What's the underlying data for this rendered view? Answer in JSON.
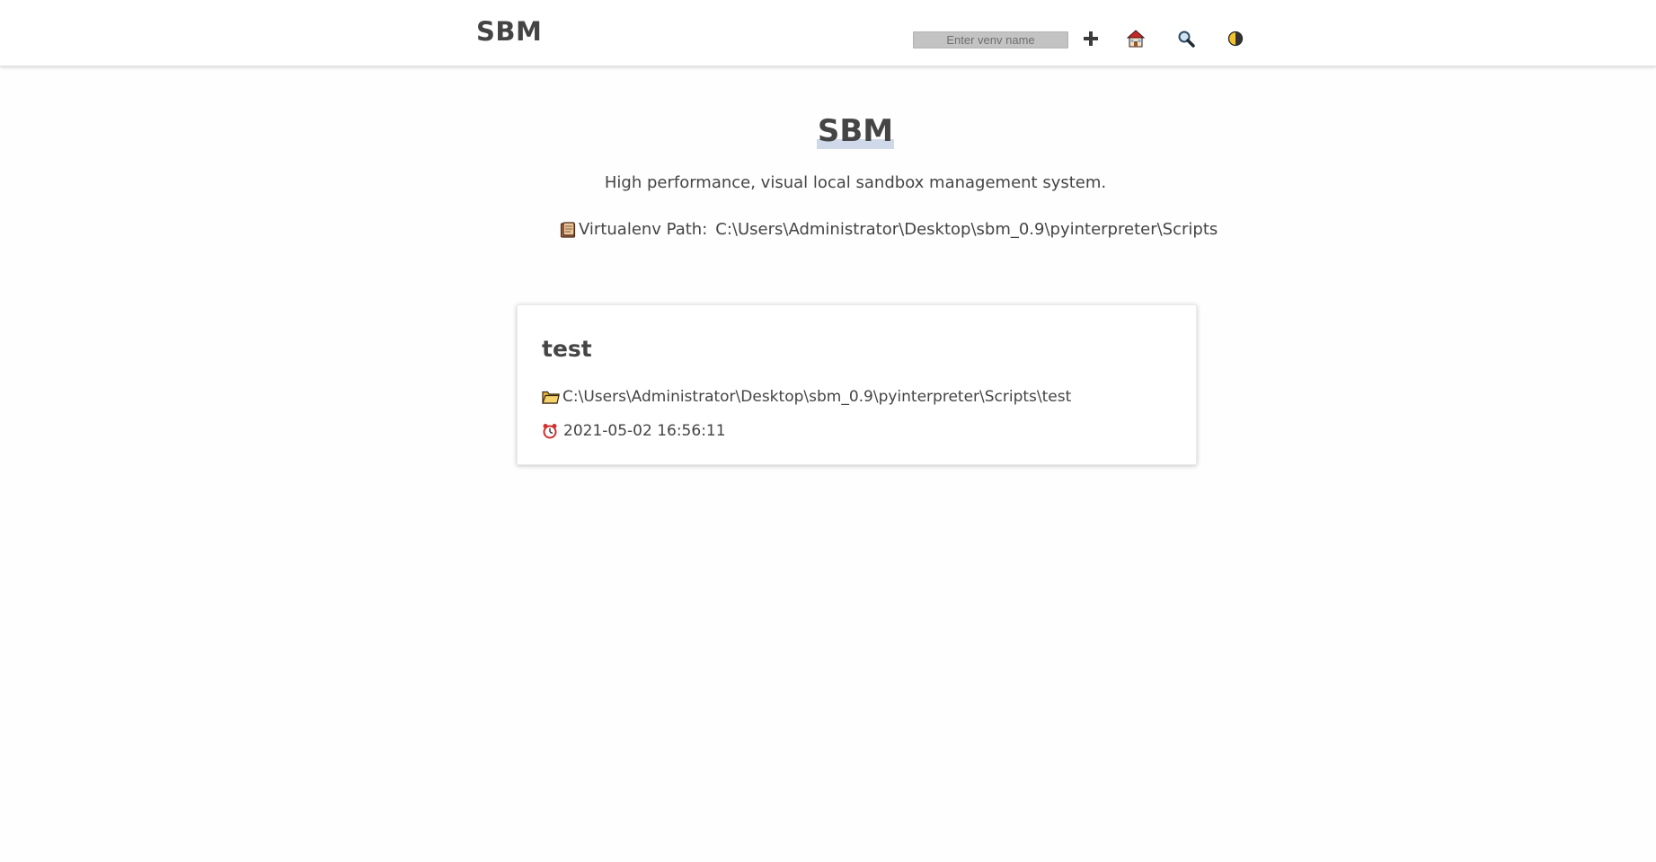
{
  "header": {
    "brand": "SBM",
    "search_placeholder": "Enter venv name",
    "icons": [
      "plus-icon",
      "house-icon",
      "magnifier-icon",
      "theme-toggle-icon"
    ]
  },
  "hero": {
    "title": "SBM",
    "subtitle": "High performance, visual local sandbox management system.",
    "path_label": "Virtualenv Path:",
    "path_value": "C:\\Users\\Administrator\\Desktop\\sbm_0.9\\pyinterpreter\\Scripts",
    "path_icon": "notebook-icon"
  },
  "venvs": [
    {
      "name": "test",
      "path": "C:\\Users\\Administrator\\Desktop\\sbm_0.9\\pyinterpreter\\Scripts\\test",
      "created": "2021-05-02 16:56:11",
      "path_icon": "folder-icon",
      "time_icon": "alarm-clock-icon"
    }
  ],
  "colors": {
    "text": "#444444",
    "input_bg": "#c3c3c3",
    "highlight": "#cfd9ea"
  }
}
